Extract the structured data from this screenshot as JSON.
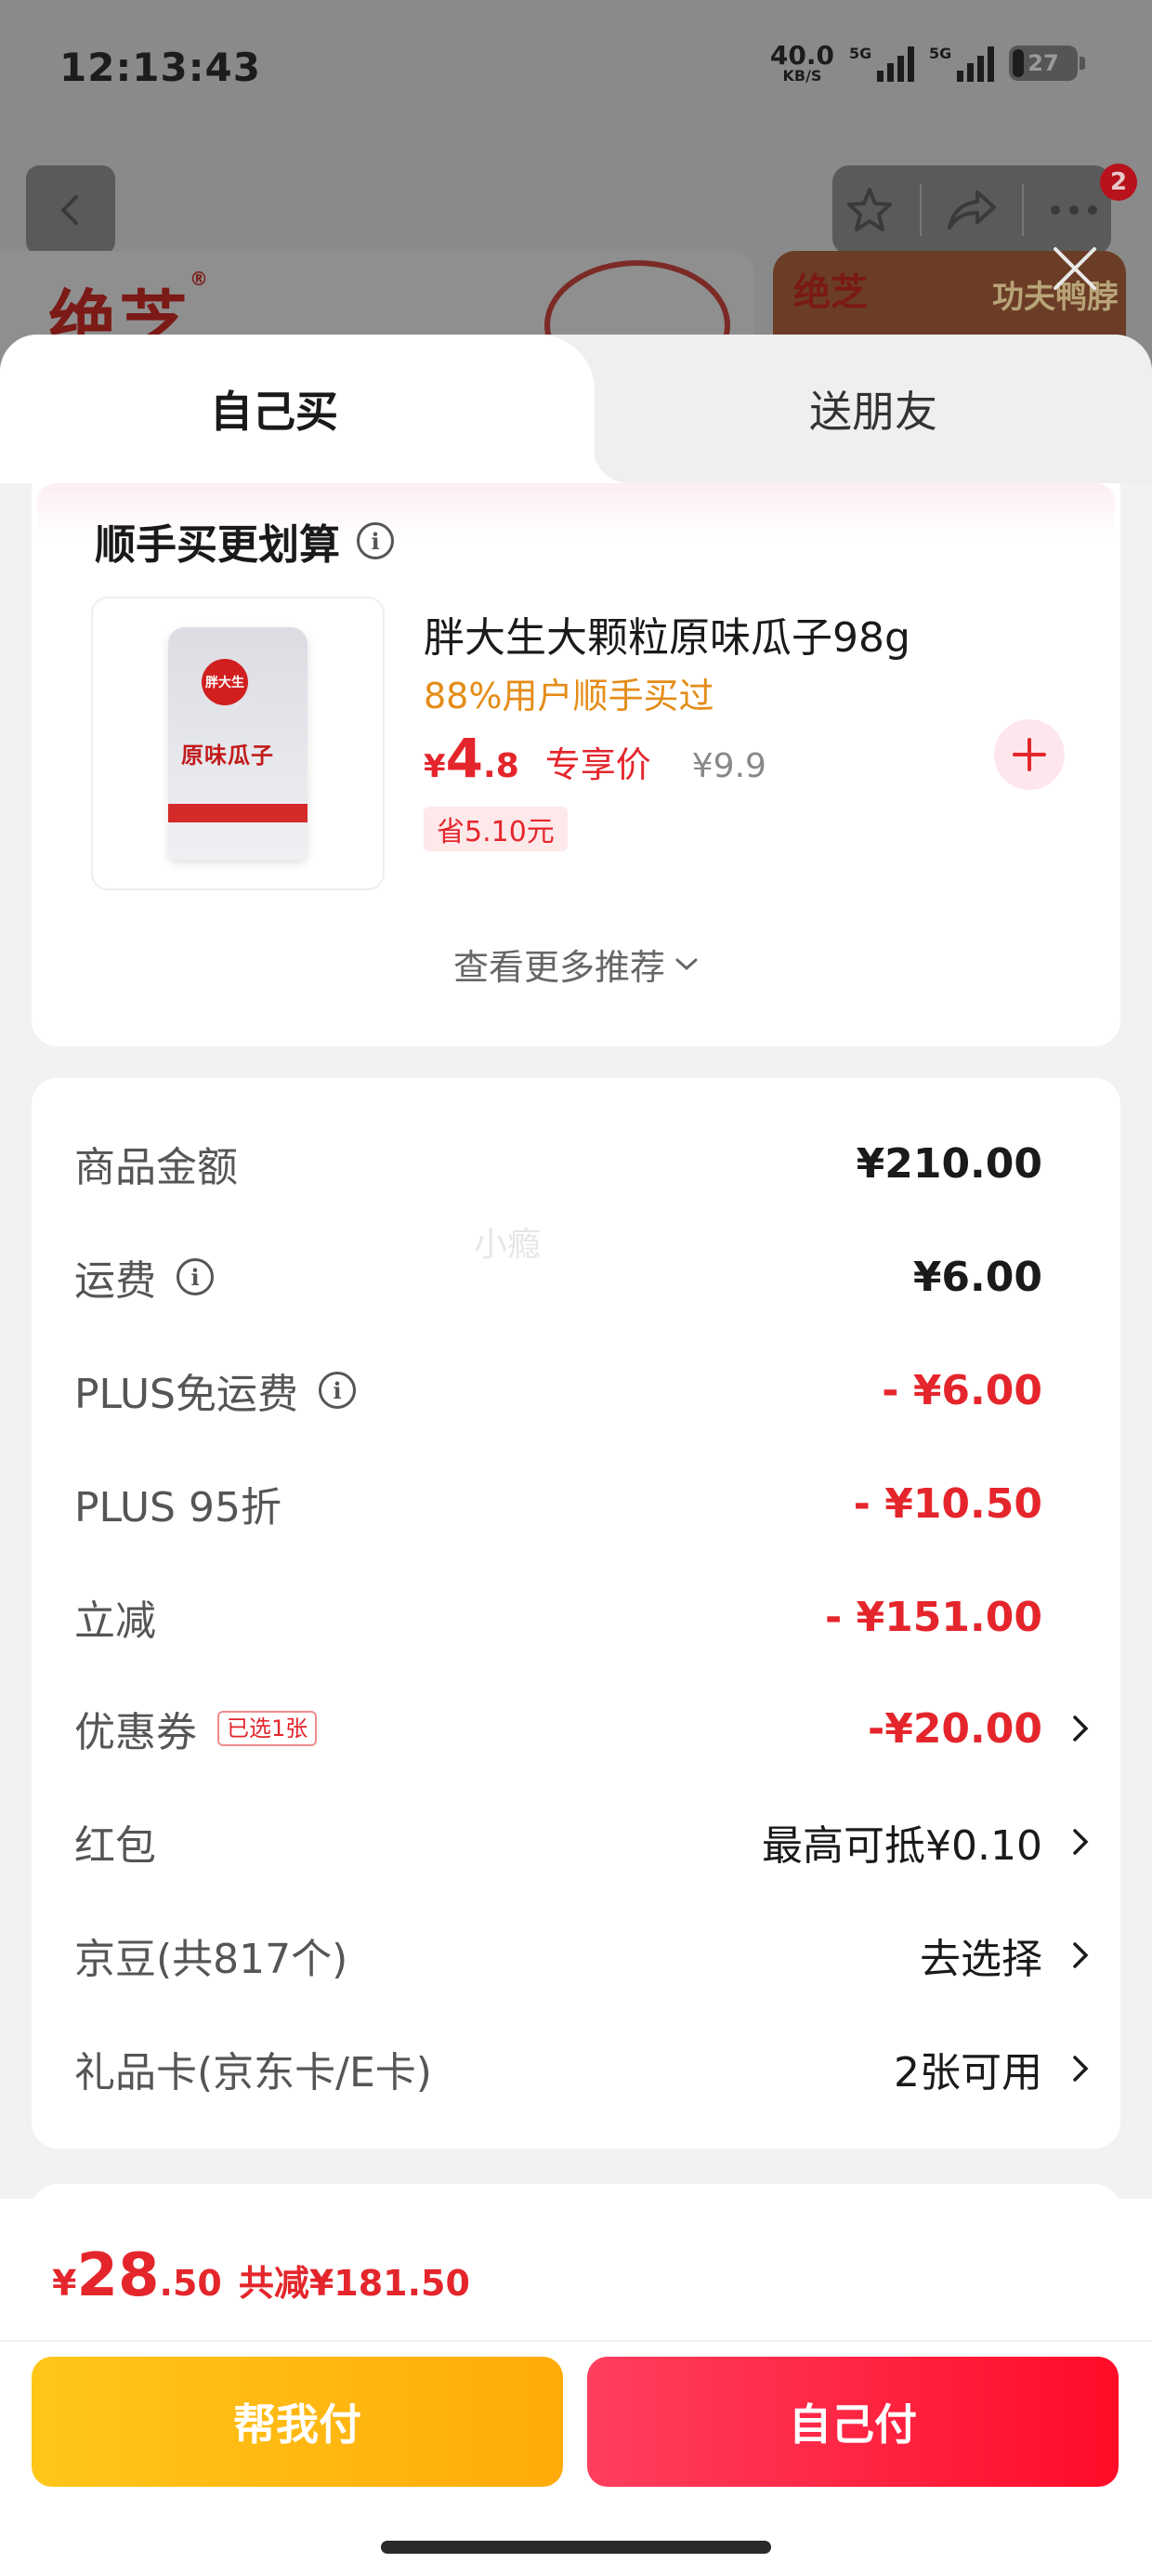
{
  "status_bar": {
    "time": "12:13:43",
    "net_speed_value": "40.0",
    "net_speed_unit": "KB/S",
    "signal1_label": "5G",
    "signal2_label": "5G",
    "battery": "27"
  },
  "top_nav": {
    "back_icon": "chevron-left-icon",
    "star_icon": "star-icon",
    "share_icon": "share-icon",
    "more_icon": "more-icon",
    "badge_count": "2"
  },
  "banner": {
    "logo_text": "绝芝",
    "logo_mark": "®",
    "right_logo": "绝芝",
    "right_slogan": "功夫鸭脖"
  },
  "tabs": {
    "self_buy": "自己买",
    "send_friend": "送朋友"
  },
  "recommend": {
    "title": "顺手买更划算",
    "product_name": "胖大生大颗粒原味瓜子98g",
    "users_text": "88%用户顺手买过",
    "price_symbol": "¥",
    "price_int": "4",
    "price_dec": ".8",
    "price_tag": "专享价",
    "orig_price": "¥9.9",
    "save_text": "省5.10元",
    "bag_brand": "胖大生",
    "bag_name": "原味瓜子",
    "more_text": "查看更多推荐"
  },
  "summary": {
    "rows": [
      {
        "label": "商品金额",
        "value": "¥210.00"
      },
      {
        "label": "运费",
        "value": "¥6.00"
      },
      {
        "label": "PLUS免运费",
        "value": "- ¥6.00"
      },
      {
        "label": "PLUS 95折",
        "value": "- ¥10.50"
      },
      {
        "label": "立减",
        "value": "- ¥151.00"
      },
      {
        "label": "优惠券",
        "chip": "已选1张",
        "value": "-¥20.00"
      },
      {
        "label": "红包",
        "value": "最高可抵¥0.10"
      },
      {
        "label": "京豆(共817个)",
        "value": "去选择"
      },
      {
        "label": "礼品卡(京东卡/E卡)",
        "value": "2张可用"
      }
    ],
    "watermark": "小瘾"
  },
  "footer": {
    "price_symbol": "¥",
    "price_int": "28",
    "price_dec": ".50",
    "discount_text": "共减¥181.50",
    "help_pay": "帮我付",
    "self_pay": "自己付"
  },
  "colors": {
    "accent_red": "#e4262c",
    "orange": "#e48c18",
    "button_yellow": "#ffb80f",
    "button_red": "#ff1f3d"
  }
}
